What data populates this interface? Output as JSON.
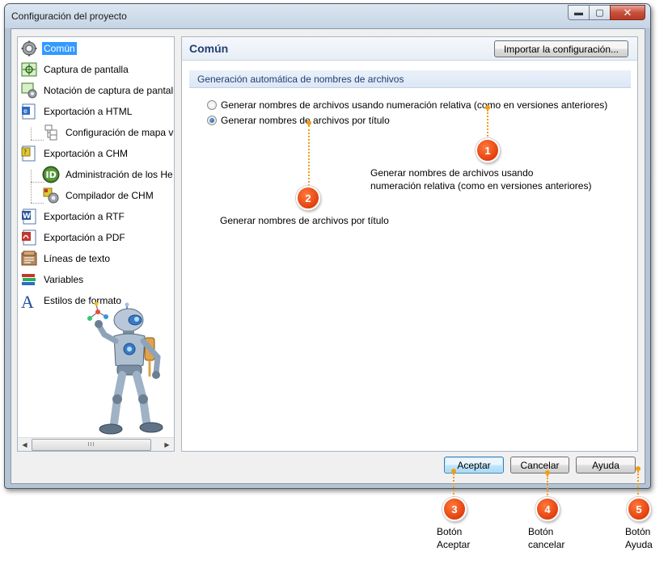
{
  "window": {
    "title": "Configuración del proyecto",
    "minimize_glyph": "▬",
    "maximize_glyph": "▢",
    "close_glyph": "✕"
  },
  "tree": {
    "items": [
      {
        "label": "Común",
        "icon": "gear-icon",
        "selected": true
      },
      {
        "label": "Captura de pantalla",
        "icon": "screen-capture-icon"
      },
      {
        "label": "Notación de captura de pantal",
        "icon": "capture-annotation-icon"
      },
      {
        "label": "Exportación a HTML",
        "icon": "html-export-icon"
      },
      {
        "label": "Configuración de mapa v",
        "icon": "sitemap-icon"
      },
      {
        "label": "Exportación a CHM",
        "icon": "chm-export-icon"
      },
      {
        "label": "Administración de los He",
        "icon": "id-icon"
      },
      {
        "label": "Compilador de CHM",
        "icon": "chm-compiler-icon"
      },
      {
        "label": "Exportación a RTF",
        "icon": "rtf-export-icon"
      },
      {
        "label": "Exportación a PDF",
        "icon": "pdf-export-icon"
      },
      {
        "label": "Líneas de texto",
        "icon": "text-lines-icon"
      },
      {
        "label": "Variables",
        "icon": "variables-icon"
      },
      {
        "label": "Estilos de formato",
        "icon": "format-styles-icon"
      }
    ],
    "scroll_grip": "III",
    "scroll_left": "◀",
    "scroll_right": "▶"
  },
  "panel": {
    "title": "Común",
    "import_button": "Importar la configuración...",
    "section_title": "Generación automática de nombres de archivos",
    "options": [
      {
        "label": "Generar nombres de archivos usando numeración relativa (como en versiones anteriores)",
        "checked": false
      },
      {
        "label": "Generar nombres de archivos por título",
        "checked": true
      }
    ]
  },
  "footer": {
    "accept": "Aceptar",
    "cancel": "Cancelar",
    "help": "Ayuda"
  },
  "callouts": {
    "c1": {
      "number": "1",
      "text_line1": "Generar nombres de archivos usando",
      "text_line2": "numeración relativa (como en versiones anteriores)"
    },
    "c2": {
      "number": "2",
      "text": "Generar nombres de archivos por título"
    },
    "c3": {
      "number": "3",
      "text_line1": "Botón",
      "text_line2": "Aceptar"
    },
    "c4": {
      "number": "4",
      "text_line1": "Botón",
      "text_line2": "cancelar"
    },
    "c5": {
      "number": "5",
      "text_line1": "Botón",
      "text_line2": "Ayuda"
    }
  },
  "colors": {
    "selection": "#3399ff",
    "panel_title": "#1f3f73",
    "callout": "#e2400e",
    "callout_line": "#f39c12"
  }
}
